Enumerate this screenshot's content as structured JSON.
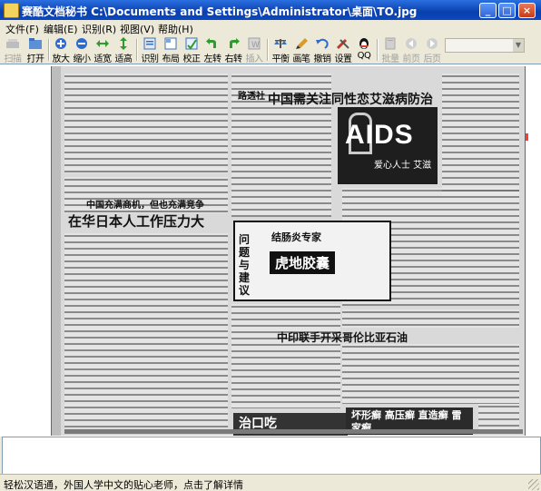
{
  "window": {
    "title": "赛酷文档秘书 C:\\Documents and Settings\\Administrator\\桌面\\TO.jpg",
    "controls": [
      "_",
      "□",
      "×"
    ]
  },
  "menu": [
    "文件(F)",
    "编辑(E)",
    "识别(R)",
    "视图(V)",
    "帮助(H)"
  ],
  "toolbar": {
    "scan": "扫描",
    "open": "打开",
    "zoom_in": "放大",
    "zoom_out": "缩小",
    "fit_width": "适宽",
    "fit_height": "适高",
    "recognize": "识别",
    "layout": "布局",
    "correct": "校正",
    "rotate_left": "左转",
    "rotate_right": "右转",
    "insert": "插入",
    "balance": "平衡",
    "paint": "画笔",
    "undo": "撤销",
    "settings": "设置",
    "qq": "QQ",
    "batch": "批量",
    "prev": "前页",
    "next": "后页",
    "combo_value": ""
  },
  "document": {
    "headline_main": "中国需关注同性恋艾滋病防治",
    "headline_2a": "中国充满商机，但也充满竞争",
    "headline_2b": "在华日本人工作压力大",
    "headline_3": "中印联手开采哥伦比亚石油",
    "aids_word": "AIDS",
    "aids_sub": "爱心人士 艾滋",
    "ad_big": "虎地胶囊",
    "ad_side": "问题与建议",
    "ad_top": "结肠炎专家",
    "ad_bottom_left": "治口吃",
    "ad_bottom_right": "坏形癣 高压癣 直造癣 雷家癣"
  },
  "status": {
    "text": "轻松汉语通，外国人学中文的贴心老师，点击了解详情"
  }
}
